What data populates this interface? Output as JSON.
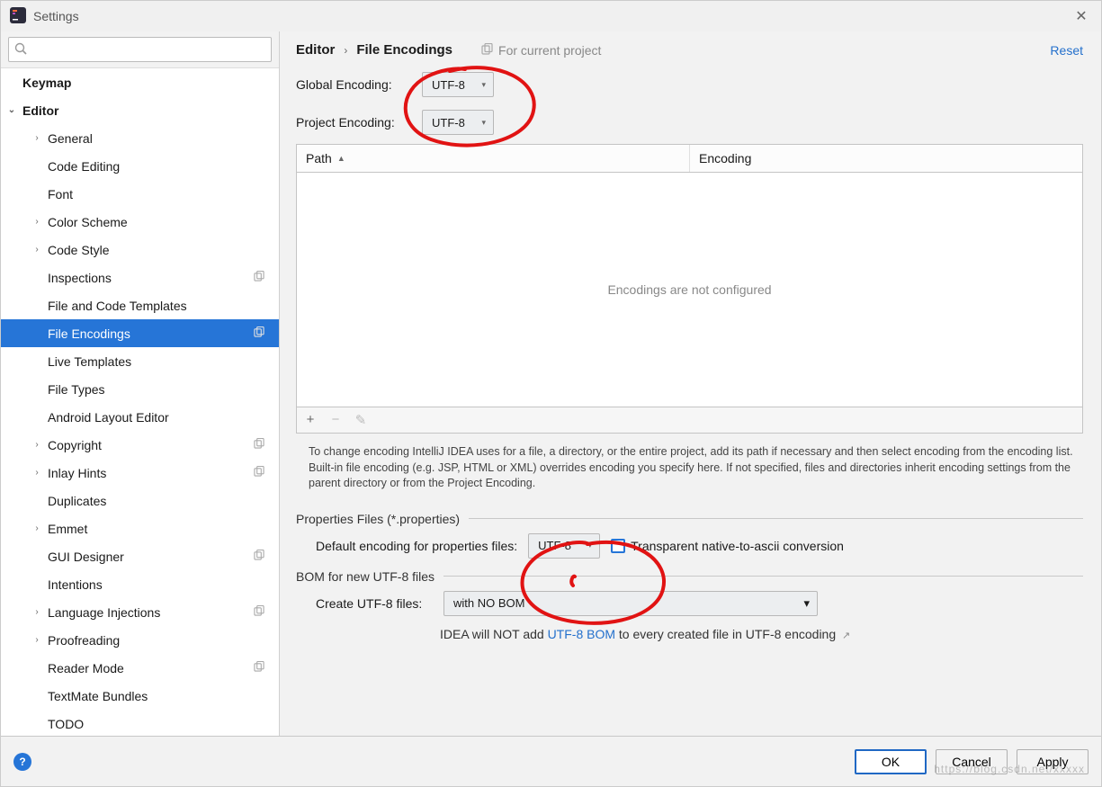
{
  "window": {
    "title": "Settings"
  },
  "search": {
    "placeholder": ""
  },
  "breadcrumb": {
    "part1": "Editor",
    "part2": "File Encodings",
    "context": "For current project",
    "reset": "Reset"
  },
  "sidebar": {
    "items": [
      {
        "label": "Keymap",
        "depth": 1,
        "bold": true,
        "chevron": "",
        "copy": false
      },
      {
        "label": "Editor",
        "depth": 1,
        "bold": true,
        "chevron": "down",
        "copy": false
      },
      {
        "label": "General",
        "depth": 2,
        "chevron": "right",
        "copy": false
      },
      {
        "label": "Code Editing",
        "depth": 2,
        "chevron": "",
        "copy": false
      },
      {
        "label": "Font",
        "depth": 2,
        "chevron": "",
        "copy": false
      },
      {
        "label": "Color Scheme",
        "depth": 2,
        "chevron": "right",
        "copy": false
      },
      {
        "label": "Code Style",
        "depth": 2,
        "chevron": "right",
        "copy": false
      },
      {
        "label": "Inspections",
        "depth": 2,
        "chevron": "",
        "copy": true
      },
      {
        "label": "File and Code Templates",
        "depth": 2,
        "chevron": "",
        "copy": false
      },
      {
        "label": "File Encodings",
        "depth": 2,
        "chevron": "",
        "copy": true,
        "selected": true
      },
      {
        "label": "Live Templates",
        "depth": 2,
        "chevron": "",
        "copy": false
      },
      {
        "label": "File Types",
        "depth": 2,
        "chevron": "",
        "copy": false
      },
      {
        "label": "Android Layout Editor",
        "depth": 2,
        "chevron": "",
        "copy": false
      },
      {
        "label": "Copyright",
        "depth": 2,
        "chevron": "right",
        "copy": true
      },
      {
        "label": "Inlay Hints",
        "depth": 2,
        "chevron": "right",
        "copy": true
      },
      {
        "label": "Duplicates",
        "depth": 2,
        "chevron": "",
        "copy": false
      },
      {
        "label": "Emmet",
        "depth": 2,
        "chevron": "right",
        "copy": false
      },
      {
        "label": "GUI Designer",
        "depth": 2,
        "chevron": "",
        "copy": true
      },
      {
        "label": "Intentions",
        "depth": 2,
        "chevron": "",
        "copy": false
      },
      {
        "label": "Language Injections",
        "depth": 2,
        "chevron": "right",
        "copy": true
      },
      {
        "label": "Proofreading",
        "depth": 2,
        "chevron": "right",
        "copy": false
      },
      {
        "label": "Reader Mode",
        "depth": 2,
        "chevron": "",
        "copy": true
      },
      {
        "label": "TextMate Bundles",
        "depth": 2,
        "chevron": "",
        "copy": false
      },
      {
        "label": "TODO",
        "depth": 2,
        "chevron": "",
        "copy": false
      }
    ]
  },
  "encodings": {
    "global_label": "Global Encoding:",
    "global_value": "UTF-8",
    "project_label": "Project Encoding:",
    "project_value": "UTF-8"
  },
  "table": {
    "col_path": "Path",
    "col_encoding": "Encoding",
    "empty_message": "Encodings are not configured",
    "btn_add": "+",
    "btn_remove": "−",
    "btn_edit": "✎"
  },
  "help_text": "To change encoding IntelliJ IDEA uses for a file, a directory, or the entire project, add its path if necessary and then select encoding from the encoding list. Built-in file encoding (e.g. JSP, HTML or XML) overrides encoding you specify here. If not specified, files and directories inherit encoding settings from the parent directory or from the Project Encoding.",
  "properties": {
    "section_title": "Properties Files (*.properties)",
    "default_label": "Default encoding for properties files:",
    "default_value": "UTF-8",
    "checkbox_label": "Transparent native-to-ascii conversion"
  },
  "bom": {
    "section_title": "BOM for new UTF-8 files",
    "create_label": "Create UTF-8 files:",
    "create_value": "with NO BOM",
    "note_prefix": "IDEA will NOT add ",
    "note_link": "UTF-8 BOM",
    "note_suffix": " to every created file in UTF-8 encoding"
  },
  "buttons": {
    "ok": "OK",
    "cancel": "Cancel",
    "apply": "Apply"
  }
}
